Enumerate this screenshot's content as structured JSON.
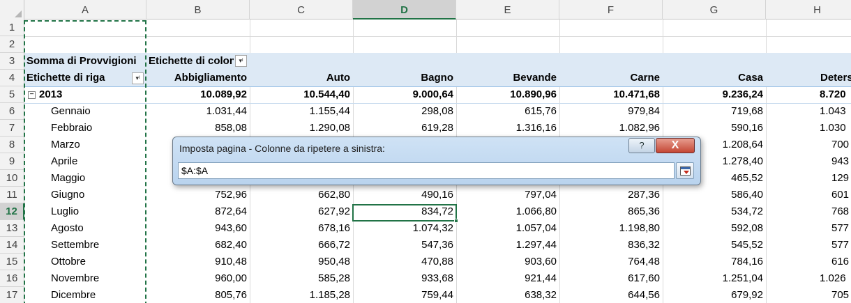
{
  "columns": [
    "A",
    "B",
    "C",
    "D",
    "E",
    "F",
    "G",
    "H"
  ],
  "selected_column": "D",
  "rows": [
    "1",
    "2",
    "3",
    "4",
    "5",
    "6",
    "7",
    "8",
    "9",
    "10",
    "11",
    "12",
    "13",
    "14",
    "15",
    "16",
    "17"
  ],
  "selected_row": "12",
  "pivot": {
    "values_label": "Somma di Provvigioni",
    "col_labels_caption": "Etichette di colonne",
    "row_labels_caption": "Etichette di riga",
    "headers": [
      "Abbigliamento",
      "Auto",
      "Bagno",
      "Bevande",
      "Carne",
      "Casa",
      "Detersivi"
    ],
    "year": {
      "label": "2013",
      "values": [
        "10.089,92",
        "10.544,40",
        "9.000,64",
        "10.890,96",
        "10.471,68",
        "9.236,24",
        "8.720"
      ]
    },
    "months": [
      {
        "label": "Gennaio",
        "values": [
          "1.031,44",
          "1.155,44",
          "298,08",
          "615,76",
          "979,84",
          "719,68",
          "1.043"
        ]
      },
      {
        "label": "Febbraio",
        "values": [
          "858,08",
          "1.290,08",
          "619,28",
          "1.316,16",
          "1.082,96",
          "590,16",
          "1.030"
        ]
      },
      {
        "label": "Marzo",
        "values": [
          "",
          "",
          "",
          "",
          "",
          "1.208,64",
          "700"
        ]
      },
      {
        "label": "Aprile",
        "values": [
          "",
          "",
          "",
          "",
          "",
          "1.278,40",
          "943"
        ]
      },
      {
        "label": "Maggio",
        "values": [
          "",
          "",
          "",
          "",
          "",
          "465,52",
          "129"
        ]
      },
      {
        "label": "Giugno",
        "values": [
          "752,96",
          "662,80",
          "490,16",
          "797,04",
          "287,36",
          "586,40",
          "601"
        ]
      },
      {
        "label": "Luglio",
        "values": [
          "872,64",
          "627,92",
          "834,72",
          "1.066,80",
          "865,36",
          "534,72",
          "768"
        ]
      },
      {
        "label": "Agosto",
        "values": [
          "943,60",
          "678,16",
          "1.074,32",
          "1.057,04",
          "1.198,80",
          "592,08",
          "577"
        ]
      },
      {
        "label": "Settembre",
        "values": [
          "682,40",
          "666,72",
          "547,36",
          "1.297,44",
          "836,32",
          "545,52",
          "577"
        ]
      },
      {
        "label": "Ottobre",
        "values": [
          "910,48",
          "950,48",
          "470,88",
          "903,60",
          "764,48",
          "784,16",
          "616"
        ]
      },
      {
        "label": "Novembre",
        "values": [
          "960,00",
          "585,28",
          "933,68",
          "921,44",
          "617,60",
          "1.251,04",
          "1.026"
        ]
      },
      {
        "label": "Dicembre",
        "values": [
          "805,76",
          "1.185,28",
          "759,44",
          "638,32",
          "644,56",
          "679,92",
          "705"
        ]
      }
    ]
  },
  "dialog": {
    "title": "Imposta pagina - Colonne da ripetere a sinistra:",
    "help_label": "?",
    "close_label": "X",
    "input_value": "$A:$A"
  },
  "colors": {
    "accent": "#217346",
    "pivot_band": "#dde9f5"
  }
}
